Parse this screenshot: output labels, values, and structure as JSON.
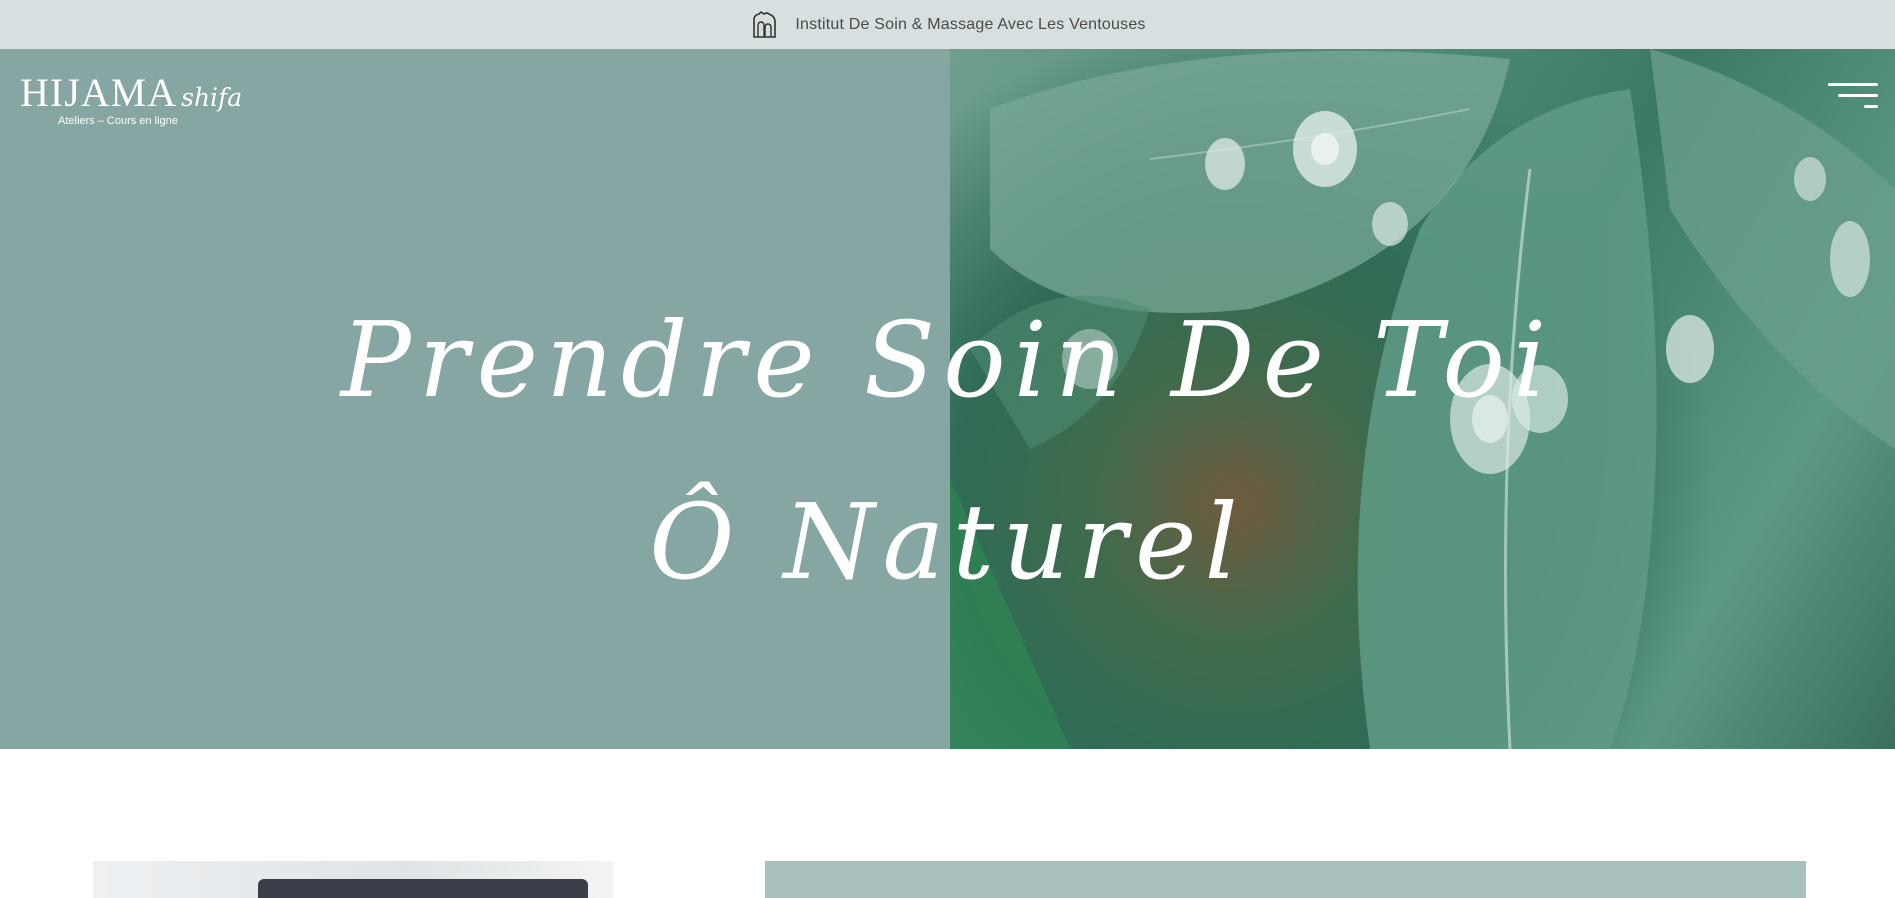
{
  "announcement": {
    "text": "Institut De Soin & Massage Avec Les Ventouses",
    "icon": "cupping-jar-icon"
  },
  "header": {
    "logo_main": "HIJAMA",
    "logo_script": "shifa",
    "logo_sub": "Ateliers – Cours en ligne",
    "menu_icon": "hamburger-menu-icon"
  },
  "hero": {
    "line1": "Prendre Soin De Toi",
    "line2": "Ô Naturel",
    "image": "leaf-with-water-drops"
  },
  "colors": {
    "topbar": "#d6e0e1",
    "hero_left": "#86a6a3",
    "panel": "#a9c1be",
    "text_dark": "#4a4a4a",
    "white": "#ffffff"
  }
}
